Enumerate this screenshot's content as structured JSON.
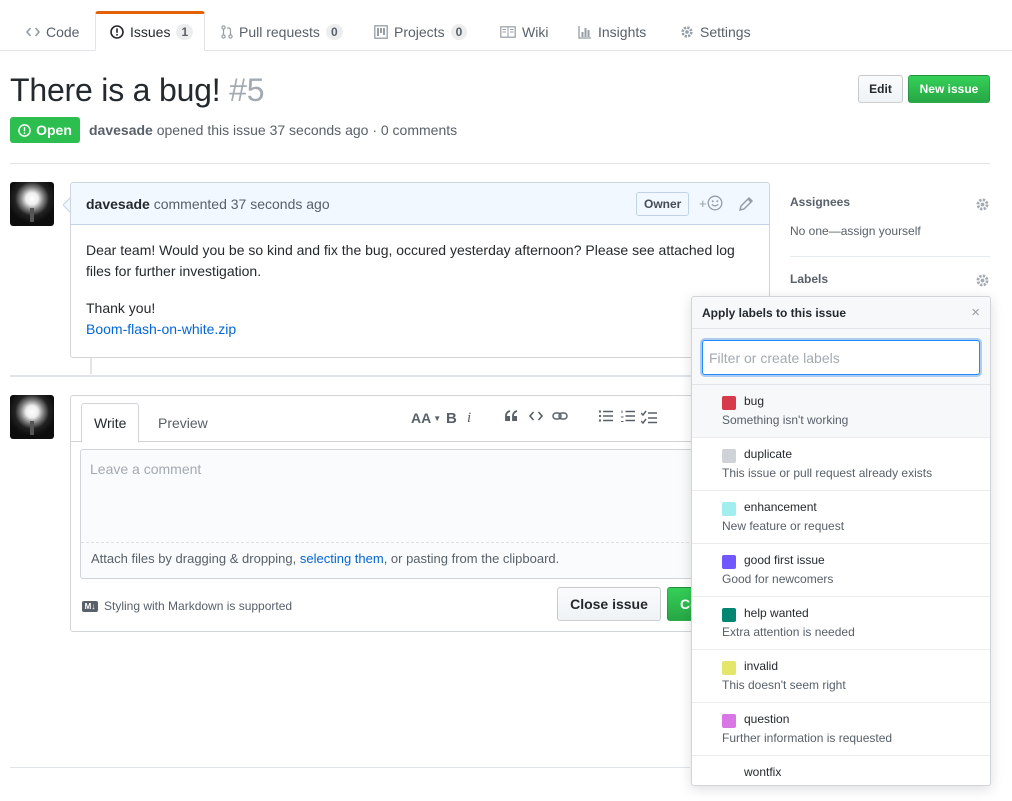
{
  "nav": {
    "tabs": [
      {
        "label": "Code",
        "icon": "code-icon"
      },
      {
        "label": "Issues",
        "count": "1",
        "icon": "issue-opened-icon"
      },
      {
        "label": "Pull requests",
        "count": "0",
        "icon": "git-pull-request-icon"
      },
      {
        "label": "Projects",
        "count": "0",
        "icon": "project-icon"
      },
      {
        "label": "Wiki",
        "icon": "book-icon"
      },
      {
        "label": "Insights",
        "icon": "graph-icon"
      },
      {
        "label": "Settings",
        "icon": "gear-icon"
      }
    ]
  },
  "issue": {
    "title": "There is a bug!",
    "number": "#5",
    "state": "Open",
    "author": "davesade",
    "meta_rest": "opened this issue 37 seconds ago · 0 comments",
    "edit_label": "Edit",
    "new_issue_label": "New issue"
  },
  "comment": {
    "author": "davesade",
    "time": "commented 37 seconds ago",
    "role": "Owner",
    "reaction": "+",
    "body": "Dear team! Would you be so kind and fix the bug, occured yesterday afternoon? Please see attached log files for further investigation.",
    "thanks": "Thank you!",
    "attachment": "Boom-flash-on-white.zip"
  },
  "form": {
    "write_tab": "Write",
    "preview_tab": "Preview",
    "toolbar": {
      "header": "AA",
      "bold": "B",
      "italic": "i"
    },
    "placeholder": "Leave a comment",
    "drag_pre": "Attach files by dragging & dropping, ",
    "drag_link": "selecting them",
    "drag_post": ", or pasting from the clipboard.",
    "markdown_note": "Styling with Markdown is supported",
    "md_badge": "M↓",
    "close_label": "Close issue",
    "comment_label": "Co"
  },
  "sidebar": {
    "assignees_title": "Assignees",
    "assignees_value": "No one—assign yourself",
    "labels_title": "Labels"
  },
  "label_popover": {
    "title": "Apply labels to this issue",
    "close": "×",
    "filter_placeholder": "Filter or create labels",
    "labels": [
      {
        "name": "bug",
        "desc": "Something isn't working",
        "color": "#d73a4a"
      },
      {
        "name": "duplicate",
        "desc": "This issue or pull request already exists",
        "color": "#cfd3d7"
      },
      {
        "name": "enhancement",
        "desc": "New feature or request",
        "color": "#a2eeef"
      },
      {
        "name": "good first issue",
        "desc": "Good for newcomers",
        "color": "#7057ff"
      },
      {
        "name": "help wanted",
        "desc": "Extra attention is needed",
        "color": "#008672"
      },
      {
        "name": "invalid",
        "desc": "This doesn't seem right",
        "color": "#e4e669"
      },
      {
        "name": "question",
        "desc": "Further information is requested",
        "color": "#d876e3"
      },
      {
        "name": "wontfix",
        "desc": "",
        "color": "#ffffff"
      }
    ]
  }
}
